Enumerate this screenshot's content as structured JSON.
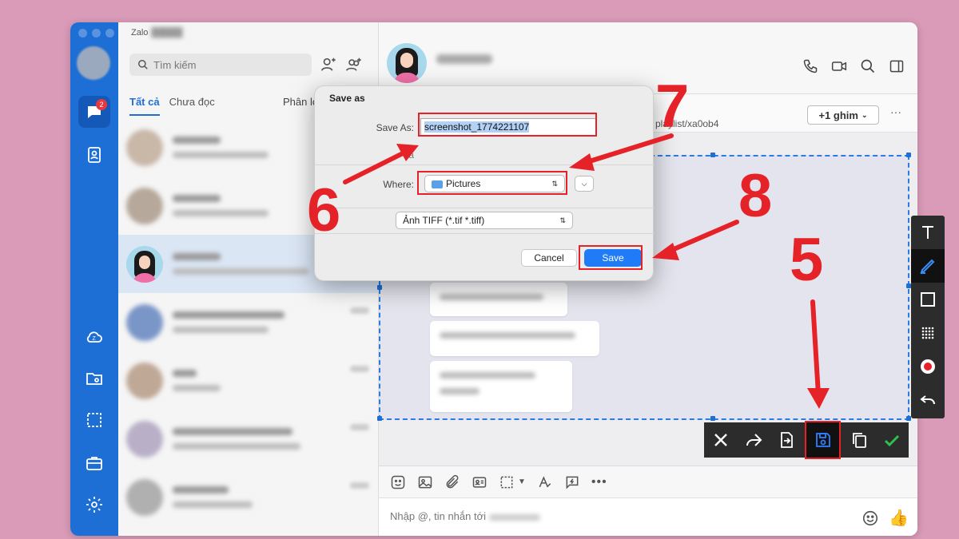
{
  "app": {
    "title": "Zalo",
    "badge_count": "2"
  },
  "list": {
    "search_placeholder": "Tìm kiếm",
    "tabs": [
      "Tất cả",
      "Chưa đọc"
    ],
    "filter_label": "Phân lo"
  },
  "chat": {
    "pin_link": "playlist/xa0ob4",
    "pin_button": "+1 ghim",
    "more": "···",
    "composer_placeholder": "Nhập @, tin nhắn tới"
  },
  "dialog": {
    "title": "Save as",
    "save_as_label": "Save As:",
    "filename": "screenshot_1774221107",
    "tags_label": "Ta",
    "where_label": "Where:",
    "where_value": "Pictures",
    "format_value": "Ảnh TIFF (*.tif *.tiff)",
    "cancel_label": "Cancel",
    "save_label": "Save"
  },
  "annotations": {
    "step5": "5",
    "step6": "6",
    "step7": "7",
    "step8": "8"
  },
  "colors": {
    "accent": "#1d6fd6",
    "annotation": "#e52228",
    "background": "#d99bb8"
  }
}
